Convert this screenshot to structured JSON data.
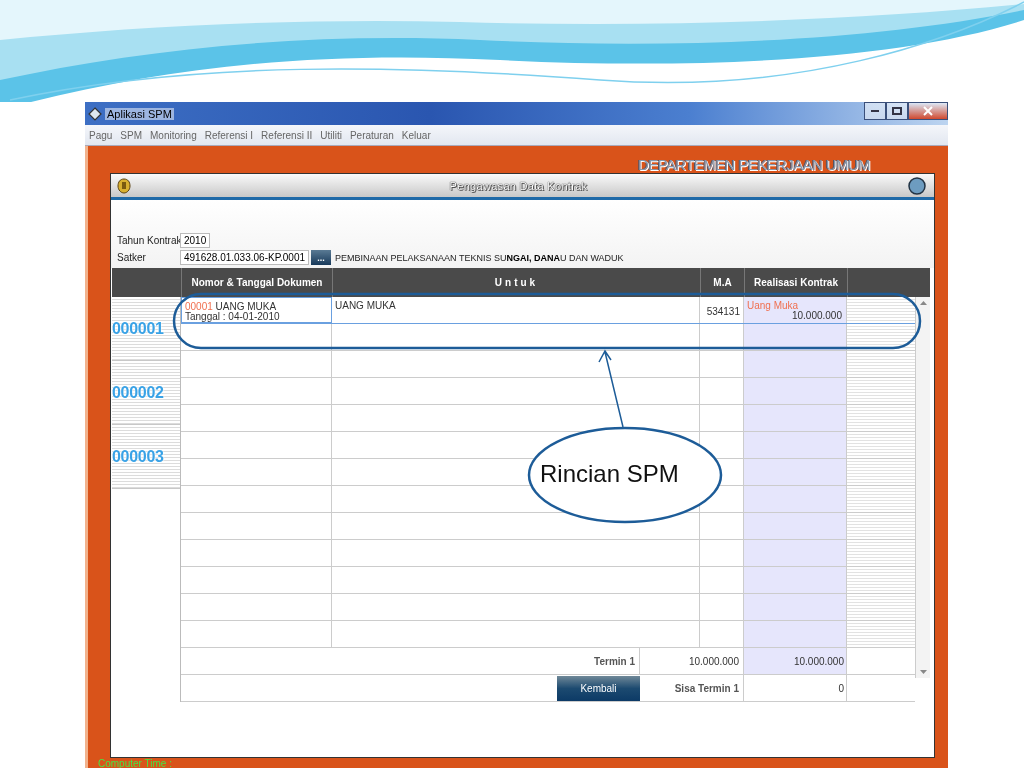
{
  "app": {
    "title": "Aplikasi SPM",
    "menu": [
      "Pagu",
      "SPM",
      "Monitoring",
      "Referensi I",
      "Referensi II",
      "Utiliti",
      "Peraturan",
      "Keluar"
    ],
    "banner": "DEPARTEMEN PEKERJAAN UMUM",
    "status": "Computer Time :"
  },
  "dialog": {
    "title": "Pengawasan Data Kontrak",
    "fields": [
      {
        "label": "Tahun Kontrak",
        "value": "2010"
      },
      {
        "label": "Satker",
        "value": "491628.01.033.06-KP.0001",
        "button": "...",
        "description": "PEMBINAAN PELAKSANAAN TEKNIS SU**NGAI, DANA**U DAN WADUK"
      }
    ],
    "table": {
      "columns": [
        "Nomor & Tanggal Dokumen",
        "Untuk",
        "M.A",
        "Realisasi Kontrak"
      ],
      "groups": [
        "000001",
        "000002",
        "000003"
      ],
      "rows": [
        {
          "number": "00001",
          "title": "UANG MUKA",
          "date": "Tanggal : 04-01-2010",
          "untuk": "UANG MUKA",
          "ma": "534131",
          "realisasi_label": "Uang Muka",
          "realisasi": "10.000.000",
          "selected": true
        }
      ],
      "totals": [
        {
          "label": "Termin 1",
          "value": "10.000.000",
          "realisasi": "10.000.000"
        },
        {
          "label": "Sisa Termin 1",
          "realisasi": "0"
        }
      ]
    },
    "button": "Kembali"
  },
  "annotation": {
    "label": "Rincian SPM"
  }
}
